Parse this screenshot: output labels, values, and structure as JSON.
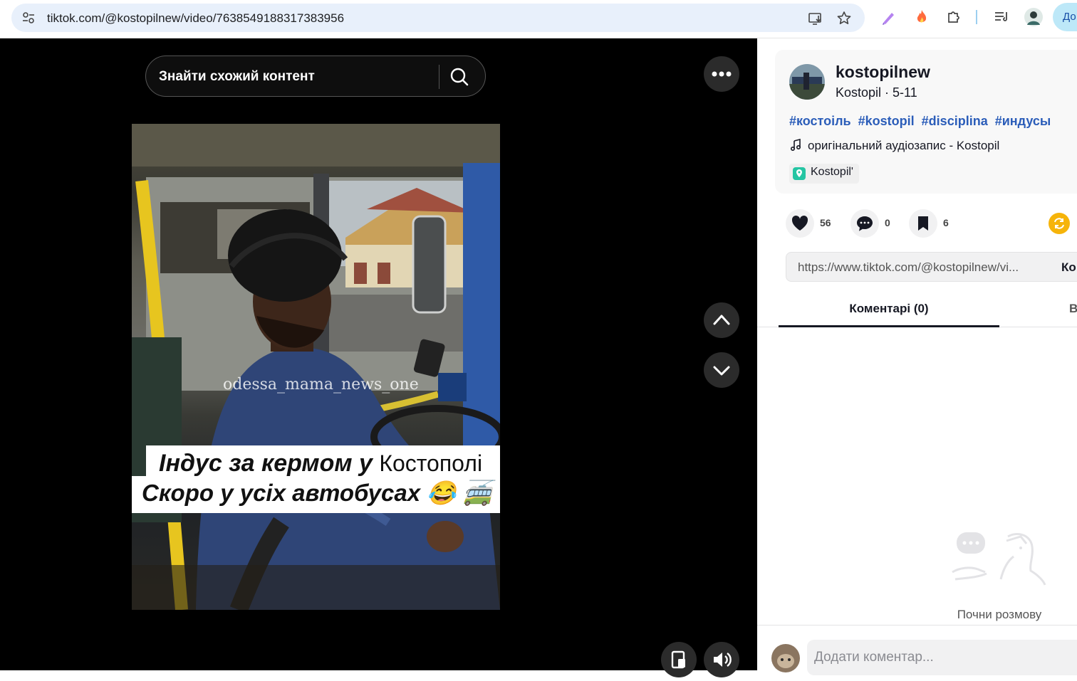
{
  "browser": {
    "url": "tiktok.com/@kostopilnew/video/7638549188317383956",
    "profile_label": "До",
    "icons": [
      "site-info-icon",
      "install-app-icon",
      "bookmark-star-icon",
      "pen-extension-icon",
      "fire-extension-icon",
      "puzzle-extensions-icon",
      "reading-list-icon",
      "profile-avatar-icon"
    ]
  },
  "video": {
    "search_placeholder": "Знайти схожий контент",
    "watermark": "odessa_mama_news_one",
    "caption_line1_bold": "Індус за кермом у ",
    "caption_line1_plain": "Костополі",
    "caption_line2": "Скоро у усіх автобусах 😂 🚎",
    "icons": [
      "search-icon",
      "more-options-icon",
      "chevron-up-icon",
      "chevron-down-icon",
      "floating-player-icon",
      "volume-icon"
    ]
  },
  "post": {
    "username": "kostopilnew",
    "subtitle": "Kostopil · 5-11",
    "hashtags": [
      "#костоіль",
      "#kostopil",
      "#disciplina",
      "#индусы"
    ],
    "music": "оригінальний аудіозапис - Kostopil",
    "location": "Kostopil'"
  },
  "actions": {
    "likes": "56",
    "comments": "0",
    "saves": "6"
  },
  "share": {
    "link": "https://www.tiktok.com/@kostopilnew/vi...",
    "copy_label": "Ко"
  },
  "tabs": {
    "comments_label": "Коментарі (0)",
    "second_label": "В"
  },
  "comments": {
    "empty_text": "Почни розмову",
    "input_placeholder": "Додати коментар..."
  },
  "colors": {
    "hashtag": "#2b5db9",
    "repost_badge": "#f6b40a",
    "video_bg": "#000000"
  }
}
